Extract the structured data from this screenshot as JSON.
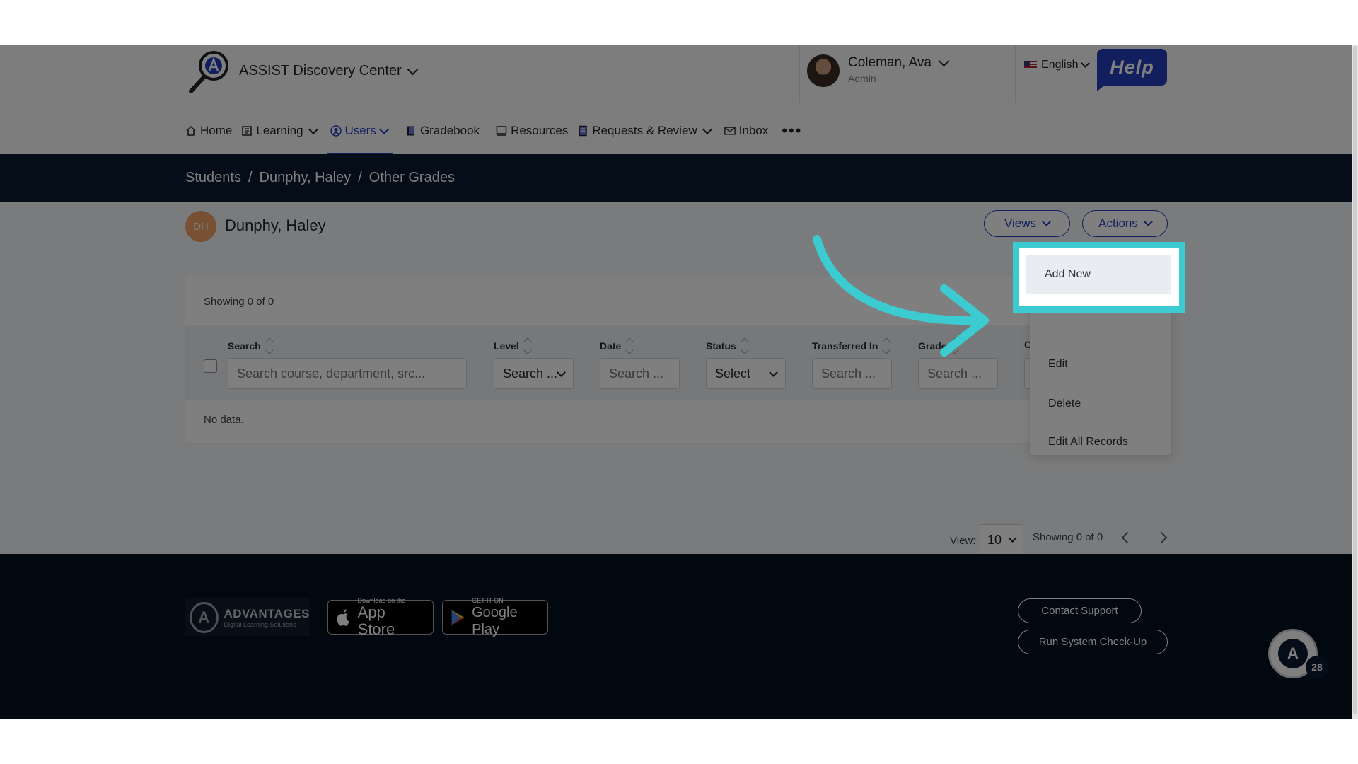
{
  "header": {
    "app_title": "ASSIST Discovery Center",
    "user": {
      "name": "Coleman, Ava",
      "role": "Admin"
    },
    "language": "English",
    "help_label": "Help"
  },
  "nav": {
    "items": [
      {
        "label": "Home",
        "icon": "home-icon"
      },
      {
        "label": "Learning",
        "icon": "learning-icon",
        "has_dropdown": true
      },
      {
        "label": "Users",
        "icon": "users-icon",
        "has_dropdown": true,
        "active": true
      },
      {
        "label": "Gradebook",
        "icon": "gradebook-icon"
      },
      {
        "label": "Resources",
        "icon": "resources-icon"
      },
      {
        "label": "Requests & Review",
        "icon": "requests-icon",
        "has_dropdown": true
      },
      {
        "label": "Inbox",
        "icon": "inbox-icon"
      }
    ],
    "more_label": "•••"
  },
  "breadcrumb": {
    "items": [
      "Students",
      "Dunphy, Haley",
      "Other Grades"
    ],
    "separator": "/"
  },
  "student": {
    "initials": "DH",
    "name": "Dunphy, Haley"
  },
  "toolbar": {
    "views_label": "Views",
    "actions_label": "Actions"
  },
  "table": {
    "showing_text": "Showing 0 of 0",
    "columns": [
      {
        "label": "Search",
        "placeholder": "Search course, department, src...",
        "type": "text"
      },
      {
        "label": "Level",
        "value": "Search ...",
        "type": "select"
      },
      {
        "label": "Date",
        "placeholder": "Search ...",
        "type": "text"
      },
      {
        "label": "Status",
        "value": "Select",
        "type": "select"
      },
      {
        "label": "Transferred In",
        "placeholder": "Search ...",
        "type": "text"
      },
      {
        "label": "Grade",
        "placeholder": "Search ...",
        "type": "text"
      },
      {
        "label": "C",
        "placeholder": "",
        "type": "text"
      }
    ],
    "empty_text": "No data."
  },
  "pagination": {
    "view_label": "View:",
    "page_size": "10",
    "showing_text": "Showing 0 of 0"
  },
  "actions_menu": {
    "items": [
      "Add New",
      "Edit",
      "Delete",
      "Edit All Records"
    ],
    "highlighted": "Add New"
  },
  "footer": {
    "brand": {
      "title": "ADVANTAGES",
      "subtitle": "Digital Learning Solutions"
    },
    "app_store": {
      "small": "Download on the",
      "big": "App Store"
    },
    "google_play": {
      "small": "GET IT ON",
      "big": "Google Play"
    },
    "contact_support": "Contact Support",
    "system_checkup": "Run System Check-Up",
    "chat_badge": "28"
  },
  "colors": {
    "accent": "#253fbd",
    "breadcrumb_bg": "#0a1a33",
    "footer_bg": "#03101f",
    "highlight": "#3ccbd0",
    "student_avatar": "#f0a268"
  }
}
